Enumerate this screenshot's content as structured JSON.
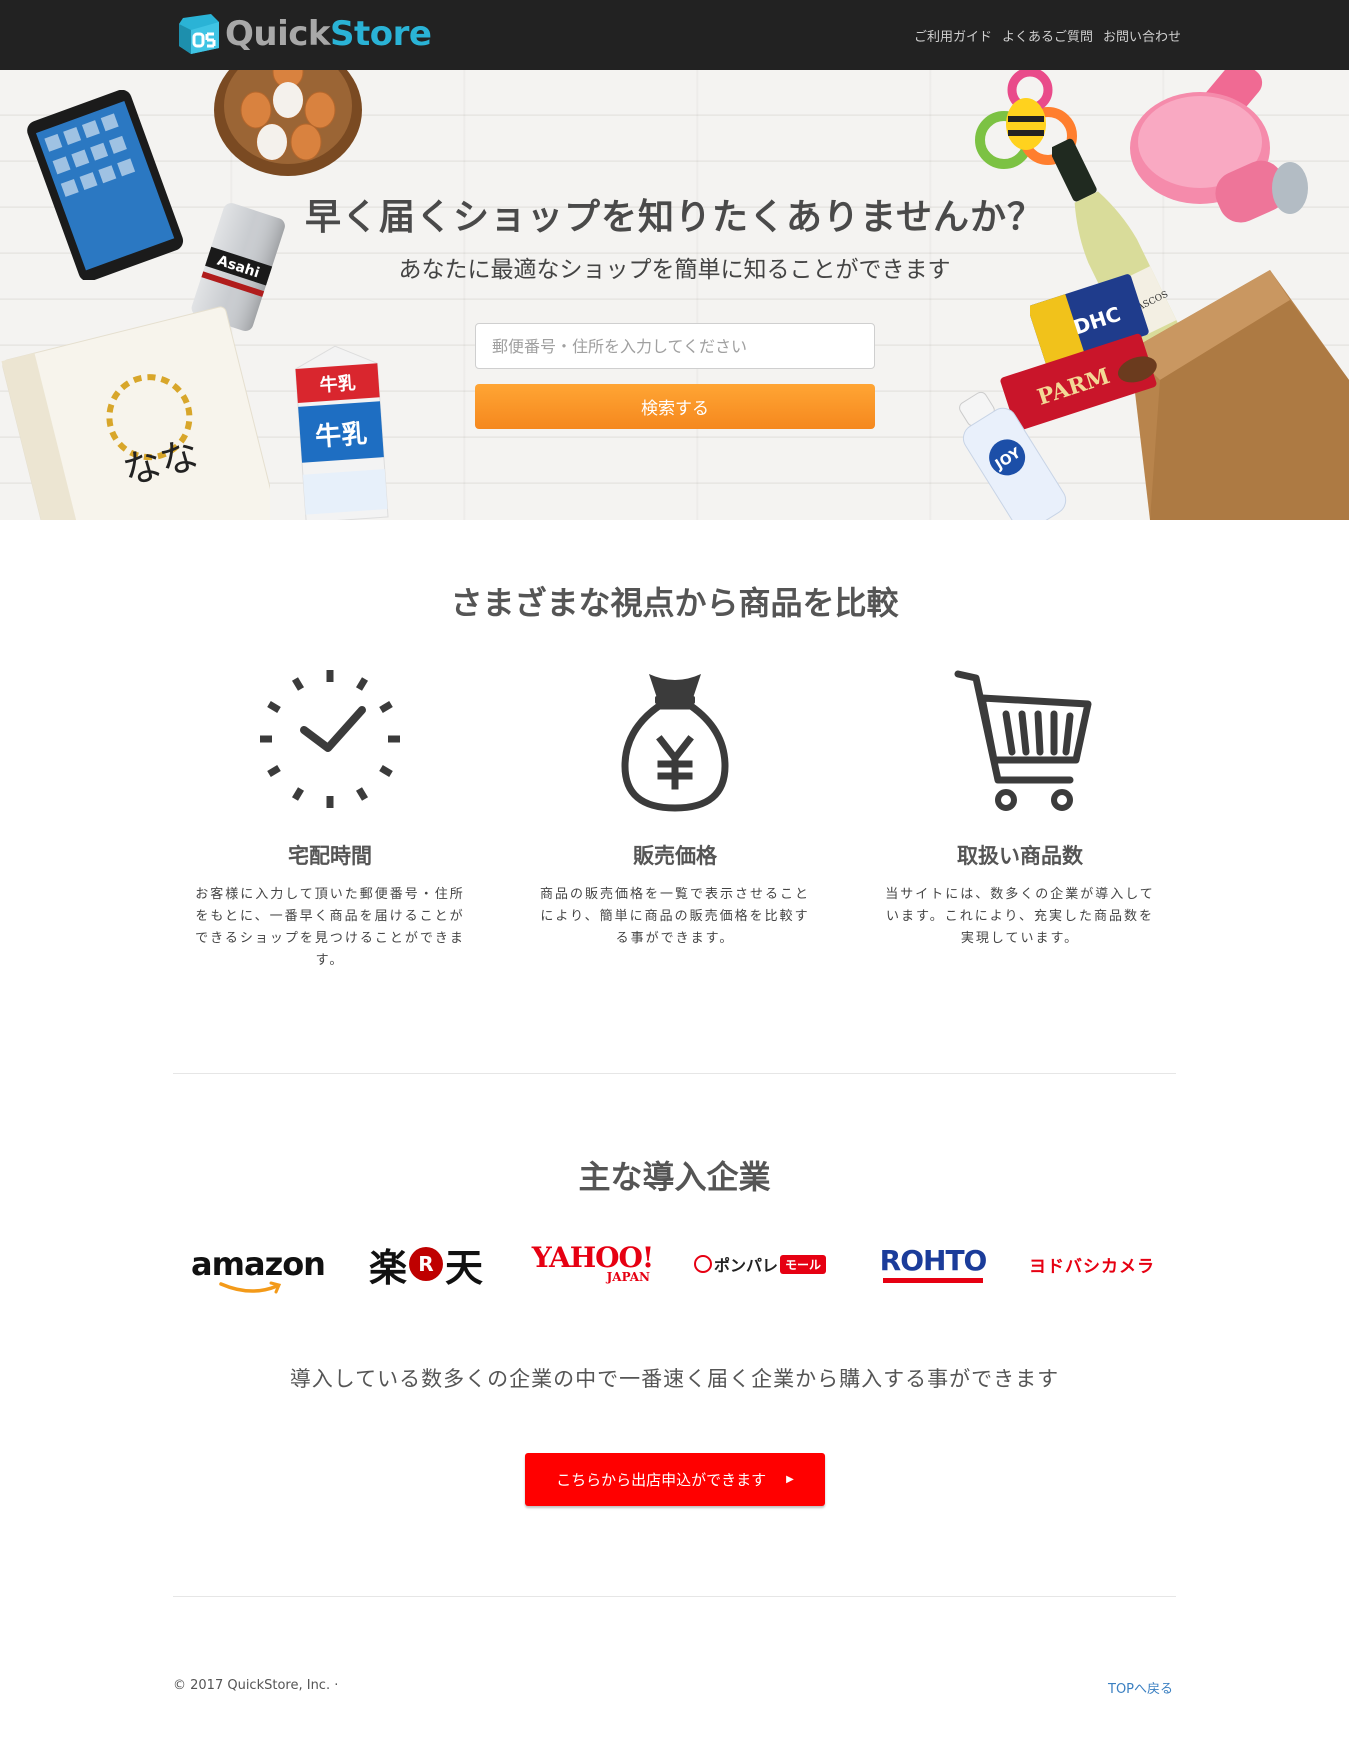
{
  "header": {
    "brand_part1": "Quick",
    "brand_part2": "Store",
    "nav": [
      "ご利用ガイド",
      "よくあるご質問",
      "お問い合わせ"
    ]
  },
  "hero": {
    "title": "早く届くショップを知りたくありませんか？",
    "subtitle": "あなたに最適なショップを簡単に知ることができます",
    "search_placeholder": "郵便番号・住所を入力してください",
    "search_button": "検索する",
    "decor_labels": {
      "beer": "Asahi",
      "milk": "牛乳",
      "rice": "なな",
      "supplement": "DHC",
      "icecream": "PARM",
      "detergent": "JOY",
      "wine": "LOS VASCOS"
    }
  },
  "features": {
    "title": "さまざまな視点から商品を比較",
    "items": [
      {
        "icon": "clock-icon",
        "heading": "宅配時間",
        "text": "お客様に入力して頂いた郵便番号・住所をもとに、一番早く商品を届けることができるショップを見つけることができます。"
      },
      {
        "icon": "money-bag-icon",
        "heading": "販売価格",
        "text": "商品の販売価格を一覧で表示させることにより、簡単に商品の販売価格を比較する事ができます。"
      },
      {
        "icon": "cart-icon",
        "heading": "取扱い商品数",
        "text": "当サイトには、数多くの企業が導入しています。これにより、充実した商品数を実現しています。"
      }
    ]
  },
  "companies": {
    "title": "主な導入企業",
    "logos": {
      "amazon": "amazon",
      "rakuten_1": "楽",
      "rakuten_r": "R",
      "rakuten_2": "天",
      "yahoo": "YAHOO!",
      "yahoo_sub": "JAPAN",
      "ponpare": "ポンパレ",
      "ponpare_tag": "モール",
      "rohto": "ROHTO",
      "yodobashi": "ヨドバシカメラ"
    },
    "lead": "導入している数多くの企業の中で一番速く届く企業から購入する事ができます",
    "cta": "こちらから出店申込ができます",
    "cta_arrow": "▶"
  },
  "footer": {
    "copyright": "© 2017 QuickStore, Inc. ·",
    "top_link": "TOPへ戻る"
  },
  "colors": {
    "header_bg": "#222222",
    "brand_accent": "#2ab3d6",
    "search_button": "#f5881e",
    "cta": "#ff0000",
    "link": "#3a7fc1"
  }
}
